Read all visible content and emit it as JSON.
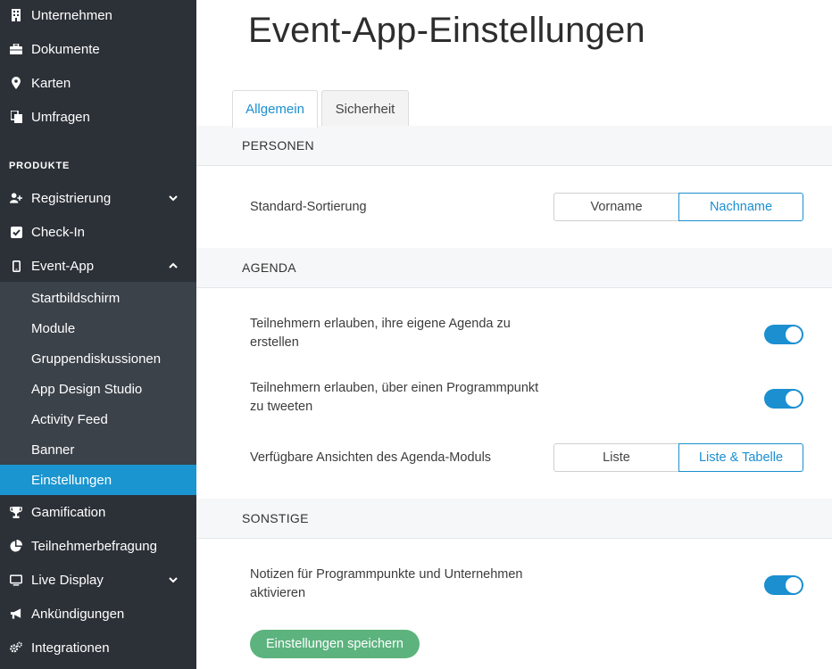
{
  "sidebar": {
    "top_items": [
      {
        "label": "Unternehmen",
        "icon": "building-icon"
      },
      {
        "label": "Dokumente",
        "icon": "briefcase-icon"
      },
      {
        "label": "Karten",
        "icon": "map-marker-icon"
      },
      {
        "label": "Umfragen",
        "icon": "copy-icon"
      }
    ],
    "section_title": "PRODUKTE",
    "registrierung": "Registrierung",
    "checkin": "Check-In",
    "eventapp": "Event-App",
    "eventapp_sub": [
      "Startbildschirm",
      "Module",
      "Gruppendiskussionen",
      "App Design Studio",
      "Activity Feed",
      "Banner",
      "Einstellungen"
    ],
    "gamification": "Gamification",
    "teilnehmerbefragung": "Teilnehmerbefragung",
    "livedisplay": "Live Display",
    "ankuendigungen": "Ankündigungen",
    "integrationen": "Integrationen"
  },
  "page": {
    "title": "Event-App-Einstellungen",
    "tabs": [
      "Allgemein",
      "Sicherheit"
    ]
  },
  "personen": {
    "heading": "PERSONEN",
    "sort_label": "Standard-Sortierung",
    "sort_options": [
      "Vorname",
      "Nachname"
    ],
    "sort_selected": "Nachname"
  },
  "agenda": {
    "heading": "AGENDA",
    "own_agenda_label": "Teilnehmern erlauben, ihre eigene Agenda zu erstellen",
    "own_agenda_on": true,
    "tweet_label": "Teilnehmern erlauben, über einen Programmpunkt zu tweeten",
    "tweet_on": true,
    "views_label": "Verfügbare Ansichten des Agenda-Moduls",
    "views_options": [
      "Liste",
      "Liste & Tabelle"
    ],
    "views_selected": "Liste & Tabelle"
  },
  "sonstige": {
    "heading": "SONSTIGE",
    "notes_label": "Notizen für Programmpunkte und Unternehmen aktivieren",
    "notes_on": true
  },
  "actions": {
    "save_label": "Einstellungen speichern"
  },
  "colors": {
    "sidebar_bg": "#2c3138",
    "submenu_bg": "#3c424a",
    "accent": "#1b8fd0",
    "active_item": "#1b95cf",
    "save_button": "#5cb37e"
  }
}
